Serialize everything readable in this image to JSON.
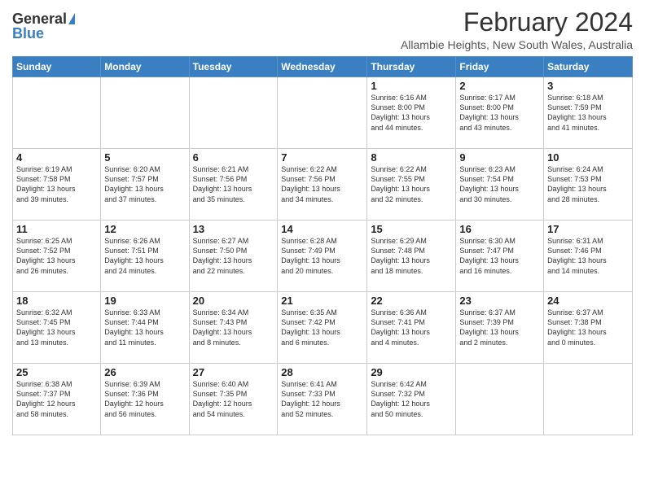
{
  "logo": {
    "general": "General",
    "blue": "Blue"
  },
  "title": "February 2024",
  "subtitle": "Allambie Heights, New South Wales, Australia",
  "days_of_week": [
    "Sunday",
    "Monday",
    "Tuesday",
    "Wednesday",
    "Thursday",
    "Friday",
    "Saturday"
  ],
  "weeks": [
    [
      {
        "day": "",
        "info": ""
      },
      {
        "day": "",
        "info": ""
      },
      {
        "day": "",
        "info": ""
      },
      {
        "day": "",
        "info": ""
      },
      {
        "day": "1",
        "info": "Sunrise: 6:16 AM\nSunset: 8:00 PM\nDaylight: 13 hours\nand 44 minutes."
      },
      {
        "day": "2",
        "info": "Sunrise: 6:17 AM\nSunset: 8:00 PM\nDaylight: 13 hours\nand 43 minutes."
      },
      {
        "day": "3",
        "info": "Sunrise: 6:18 AM\nSunset: 7:59 PM\nDaylight: 13 hours\nand 41 minutes."
      }
    ],
    [
      {
        "day": "4",
        "info": "Sunrise: 6:19 AM\nSunset: 7:58 PM\nDaylight: 13 hours\nand 39 minutes."
      },
      {
        "day": "5",
        "info": "Sunrise: 6:20 AM\nSunset: 7:57 PM\nDaylight: 13 hours\nand 37 minutes."
      },
      {
        "day": "6",
        "info": "Sunrise: 6:21 AM\nSunset: 7:56 PM\nDaylight: 13 hours\nand 35 minutes."
      },
      {
        "day": "7",
        "info": "Sunrise: 6:22 AM\nSunset: 7:56 PM\nDaylight: 13 hours\nand 34 minutes."
      },
      {
        "day": "8",
        "info": "Sunrise: 6:22 AM\nSunset: 7:55 PM\nDaylight: 13 hours\nand 32 minutes."
      },
      {
        "day": "9",
        "info": "Sunrise: 6:23 AM\nSunset: 7:54 PM\nDaylight: 13 hours\nand 30 minutes."
      },
      {
        "day": "10",
        "info": "Sunrise: 6:24 AM\nSunset: 7:53 PM\nDaylight: 13 hours\nand 28 minutes."
      }
    ],
    [
      {
        "day": "11",
        "info": "Sunrise: 6:25 AM\nSunset: 7:52 PM\nDaylight: 13 hours\nand 26 minutes."
      },
      {
        "day": "12",
        "info": "Sunrise: 6:26 AM\nSunset: 7:51 PM\nDaylight: 13 hours\nand 24 minutes."
      },
      {
        "day": "13",
        "info": "Sunrise: 6:27 AM\nSunset: 7:50 PM\nDaylight: 13 hours\nand 22 minutes."
      },
      {
        "day": "14",
        "info": "Sunrise: 6:28 AM\nSunset: 7:49 PM\nDaylight: 13 hours\nand 20 minutes."
      },
      {
        "day": "15",
        "info": "Sunrise: 6:29 AM\nSunset: 7:48 PM\nDaylight: 13 hours\nand 18 minutes."
      },
      {
        "day": "16",
        "info": "Sunrise: 6:30 AM\nSunset: 7:47 PM\nDaylight: 13 hours\nand 16 minutes."
      },
      {
        "day": "17",
        "info": "Sunrise: 6:31 AM\nSunset: 7:46 PM\nDaylight: 13 hours\nand 14 minutes."
      }
    ],
    [
      {
        "day": "18",
        "info": "Sunrise: 6:32 AM\nSunset: 7:45 PM\nDaylight: 13 hours\nand 13 minutes."
      },
      {
        "day": "19",
        "info": "Sunrise: 6:33 AM\nSunset: 7:44 PM\nDaylight: 13 hours\nand 11 minutes."
      },
      {
        "day": "20",
        "info": "Sunrise: 6:34 AM\nSunset: 7:43 PM\nDaylight: 13 hours\nand 8 minutes."
      },
      {
        "day": "21",
        "info": "Sunrise: 6:35 AM\nSunset: 7:42 PM\nDaylight: 13 hours\nand 6 minutes."
      },
      {
        "day": "22",
        "info": "Sunrise: 6:36 AM\nSunset: 7:41 PM\nDaylight: 13 hours\nand 4 minutes."
      },
      {
        "day": "23",
        "info": "Sunrise: 6:37 AM\nSunset: 7:39 PM\nDaylight: 13 hours\nand 2 minutes."
      },
      {
        "day": "24",
        "info": "Sunrise: 6:37 AM\nSunset: 7:38 PM\nDaylight: 13 hours\nand 0 minutes."
      }
    ],
    [
      {
        "day": "25",
        "info": "Sunrise: 6:38 AM\nSunset: 7:37 PM\nDaylight: 12 hours\nand 58 minutes."
      },
      {
        "day": "26",
        "info": "Sunrise: 6:39 AM\nSunset: 7:36 PM\nDaylight: 12 hours\nand 56 minutes."
      },
      {
        "day": "27",
        "info": "Sunrise: 6:40 AM\nSunset: 7:35 PM\nDaylight: 12 hours\nand 54 minutes."
      },
      {
        "day": "28",
        "info": "Sunrise: 6:41 AM\nSunset: 7:33 PM\nDaylight: 12 hours\nand 52 minutes."
      },
      {
        "day": "29",
        "info": "Sunrise: 6:42 AM\nSunset: 7:32 PM\nDaylight: 12 hours\nand 50 minutes."
      },
      {
        "day": "",
        "info": ""
      },
      {
        "day": "",
        "info": ""
      }
    ]
  ]
}
